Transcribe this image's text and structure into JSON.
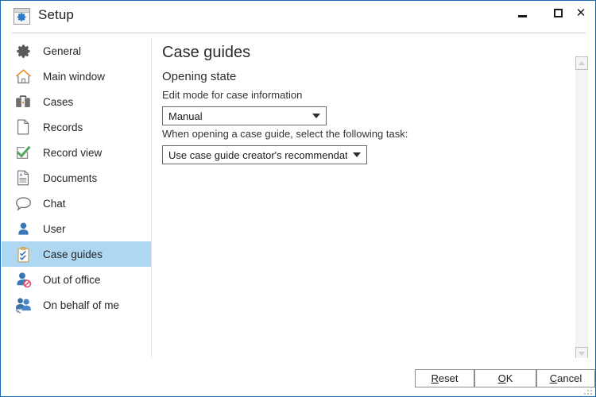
{
  "window": {
    "title": "Setup",
    "icon": "setup-gear-window-icon",
    "border_color": "#1a6bb5",
    "controls": [
      {
        "name": "minimize",
        "glyph": "minimize-icon"
      },
      {
        "name": "maximize",
        "glyph": "maximize-icon"
      },
      {
        "name": "close",
        "glyph": "close-icon",
        "label": "✕"
      }
    ]
  },
  "sidebar": {
    "selected_index": 8,
    "selected_color": "#aed7f2",
    "items": [
      {
        "label": "General",
        "icon": "gear-icon"
      },
      {
        "label": "Main window",
        "icon": "home-icon"
      },
      {
        "label": "Cases",
        "icon": "briefcase-icon"
      },
      {
        "label": "Records",
        "icon": "page-icon"
      },
      {
        "label": "Record view",
        "icon": "checkmark-box-icon"
      },
      {
        "label": "Documents",
        "icon": "document-text-icon"
      },
      {
        "label": "Chat",
        "icon": "speech-bubble-icon"
      },
      {
        "label": "User",
        "icon": "person-icon"
      },
      {
        "label": "Case guides",
        "icon": "clipboard-check-icon"
      },
      {
        "label": "Out of office",
        "icon": "person-blocked-icon"
      },
      {
        "label": "On behalf of me",
        "icon": "people-swap-icon"
      }
    ]
  },
  "content": {
    "page_title": "Case guides",
    "section_title": "Opening state",
    "fields": [
      {
        "label": "Edit mode for case information",
        "value": "Manual",
        "options": [
          "Manual"
        ]
      },
      {
        "label": "When opening a case guide, select the following task:",
        "value": "Use case guide creator's recommendation",
        "options": [
          "Use case guide creator's recommendation"
        ]
      }
    ]
  },
  "scrollbar": {
    "up_icon": "scroll-up-arrow-icon",
    "down_icon": "scroll-down-arrow-icon"
  },
  "footer": {
    "buttons": [
      {
        "name": "reset",
        "pre": "",
        "acc": "R",
        "post": "eset"
      },
      {
        "name": "ok",
        "pre": "",
        "acc": "O",
        "post": "K"
      },
      {
        "name": "cancel",
        "pre": "",
        "acc": "C",
        "post": "ancel"
      }
    ]
  }
}
